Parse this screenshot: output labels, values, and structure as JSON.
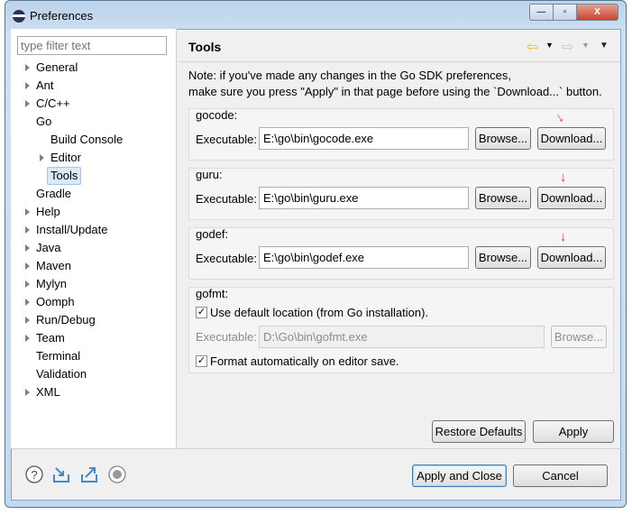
{
  "window": {
    "title": "Preferences",
    "min": "—",
    "max": "▫",
    "close": "X"
  },
  "sidebar": {
    "filter_placeholder": "type filter text",
    "items": [
      {
        "label": "General",
        "level": 0,
        "expandable": true
      },
      {
        "label": "Ant",
        "level": 0,
        "expandable": true
      },
      {
        "label": "C/C++",
        "level": 0,
        "expandable": true
      },
      {
        "label": "Go",
        "level": 0,
        "expandable": false,
        "expanded": true
      },
      {
        "label": "Build Console",
        "level": 1,
        "expandable": false
      },
      {
        "label": "Editor",
        "level": 1,
        "expandable": true
      },
      {
        "label": "Tools",
        "level": 1,
        "expandable": false,
        "selected": true
      },
      {
        "label": "Gradle",
        "level": 0,
        "expandable": false
      },
      {
        "label": "Help",
        "level": 0,
        "expandable": true
      },
      {
        "label": "Install/Update",
        "level": 0,
        "expandable": true
      },
      {
        "label": "Java",
        "level": 0,
        "expandable": true
      },
      {
        "label": "Maven",
        "level": 0,
        "expandable": true
      },
      {
        "label": "Mylyn",
        "level": 0,
        "expandable": true
      },
      {
        "label": "Oomph",
        "level": 0,
        "expandable": true
      },
      {
        "label": "Run/Debug",
        "level": 0,
        "expandable": true
      },
      {
        "label": "Team",
        "level": 0,
        "expandable": true
      },
      {
        "label": "Terminal",
        "level": 0,
        "expandable": false
      },
      {
        "label": "Validation",
        "level": 0,
        "expandable": false
      },
      {
        "label": "XML",
        "level": 0,
        "expandable": true
      }
    ]
  },
  "main": {
    "title": "Tools",
    "note1": "Note: if you've made any changes in the Go SDK preferences,",
    "note2": "make sure you press \"Apply\" in that page before using the `Download...` button.",
    "gocode": {
      "label": "gocode:",
      "exe_label": "Executable:",
      "value": "E:\\go\\bin\\gocode.exe",
      "browse": "Browse...",
      "download": "Download..."
    },
    "guru": {
      "label": "guru:",
      "exe_label": "Executable:",
      "value": "E:\\go\\bin\\guru.exe",
      "browse": "Browse...",
      "download": "Download..."
    },
    "godef": {
      "label": "godef:",
      "exe_label": "Executable:",
      "value": "E:\\go\\bin\\godef.exe",
      "browse": "Browse...",
      "download": "Download..."
    },
    "gofmt": {
      "label": "gofmt:",
      "use_default": "Use default location (from Go installation).",
      "use_default_checked": true,
      "exe_label": "Executable:",
      "value": "D:\\Go\\bin\\gofmt.exe",
      "browse": "Browse...",
      "format_on_save": "Format automatically on editor save.",
      "format_on_save_checked": true
    },
    "restore_defaults": "Restore Defaults",
    "apply": "Apply"
  },
  "footer": {
    "apply_close": "Apply and Close",
    "cancel": "Cancel"
  },
  "colors": {
    "annotation_arrow": "#e5322d",
    "selection": "#dbe8f6"
  }
}
